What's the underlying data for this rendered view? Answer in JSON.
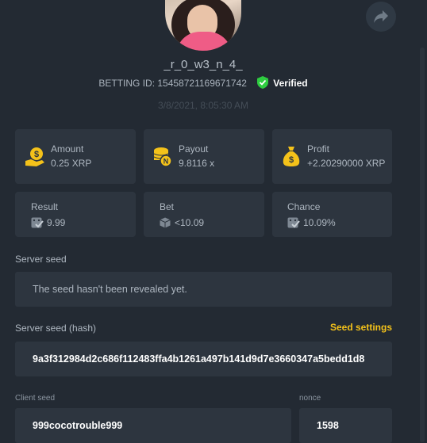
{
  "profile": {
    "username": "_r_0_w3_n_4_",
    "betting_id_label": "BETTING ID: 15458721169671742",
    "verified_label": "Verified",
    "date": "3/8/2021, 8:05:30 AM"
  },
  "stats": {
    "amount": {
      "label": "Amount",
      "value": "0.25 XRP"
    },
    "payout": {
      "label": "Payout",
      "value": "9.8116 x"
    },
    "profit": {
      "label": "Profit",
      "value": "+2.20290000 XRP"
    },
    "result": {
      "label": "Result",
      "value": "9.99"
    },
    "bet": {
      "label": "Bet",
      "value": "<10.09"
    },
    "chance": {
      "label": "Chance",
      "value": "10.09%"
    }
  },
  "server_seed": {
    "label": "Server seed",
    "value": "The seed hasn't been revealed yet."
  },
  "server_seed_hash": {
    "label": "Server seed (hash)",
    "settings_link": "Seed settings",
    "value": "9a3f312984d2c686f112483ffa4b1261a497b141d9d7e3660347a5bedd1d8"
  },
  "client_seed": {
    "label": "Client seed",
    "value": "999cocotrouble999"
  },
  "nonce": {
    "label": "nonce",
    "value": "1598"
  },
  "colors": {
    "accent": "#f4c21a",
    "verified": "#2ecc40",
    "card": "#2d353f",
    "background": "#232a33"
  }
}
